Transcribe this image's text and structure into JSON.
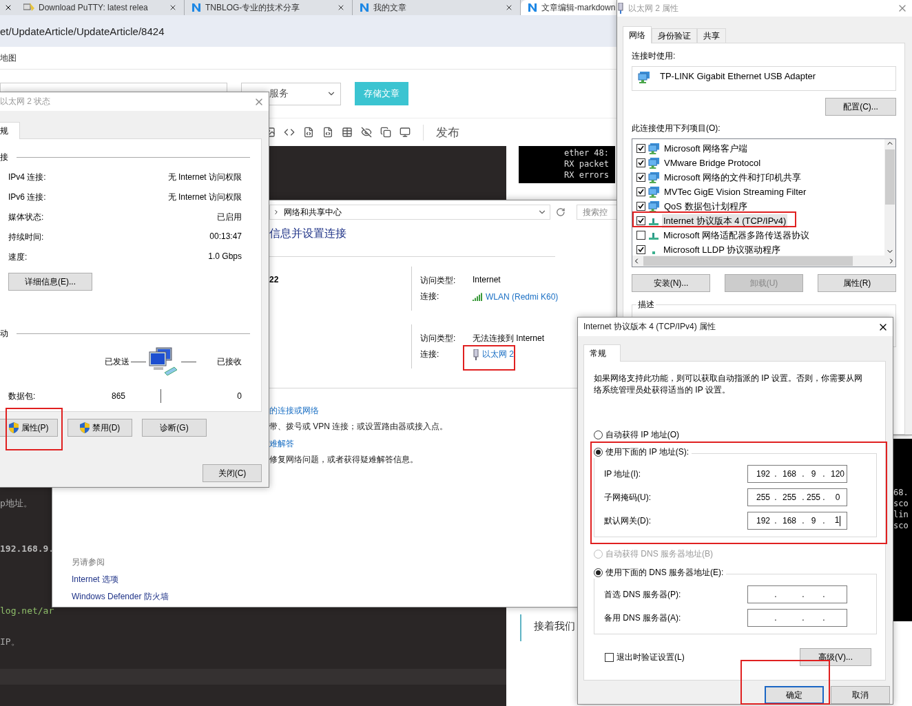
{
  "browser": {
    "tabs": [
      {
        "label": "Download PuTTY: latest relea",
        "kind": "putty",
        "selected": false
      },
      {
        "label": "TNBLOG-专业的技术分享",
        "kind": "blog",
        "selected": false
      },
      {
        "label": "我的文章",
        "kind": "blog",
        "selected": false
      },
      {
        "label": "文章编辑-markdown",
        "kind": "blog",
        "selected": true
      }
    ],
    "address": "et/UpdateArticle/UpdateArticle/8424",
    "nav": [
      "地图"
    ],
    "category_select": "服务",
    "save_button": "存储文章",
    "publish": "发布",
    "editor_lines": [
      {
        "text": "p地址。",
        "kind": "plain"
      },
      {
        "text": "192.168.9.",
        "kind": "number"
      },
      {
        "text": "log.net/ar",
        "kind": "link"
      },
      {
        "text": "IP。",
        "kind": "plain"
      }
    ],
    "terminal_lines": [
      "ether 48:",
      "RX packet",
      "RX errors"
    ],
    "terminal_lines_2": [
      "68.",
      "sco",
      "lin",
      "sco"
    ],
    "preview_quote": "接着我们"
  },
  "network_center": {
    "breadcrumb": "网络和共享中心",
    "search": {
      "placeholder": "搜索控"
    },
    "heading": "信息并设置连接",
    "network_name": "22",
    "connections": [
      {
        "access_label": "访问类型:",
        "access": "Internet",
        "conn_label": "连接:",
        "conn": "WLAN (Redmi K60)",
        "kind": "wifi"
      },
      {
        "access_label": "访问类型:",
        "access": "无法连接到 Internet",
        "conn_label": "连接:",
        "conn": "以太网 2",
        "kind": "ethernet"
      }
    ],
    "tasks": [
      {
        "link": "的连接或网络",
        "desc": "带、拨号或 VPN 连接；或设置路由器或接入点。"
      },
      {
        "link": "难解答",
        "desc": "修复网络问题，或者获得疑难解答信息。"
      }
    ],
    "see_also": {
      "title": "另请参阅",
      "links": [
        "Internet 选项",
        "Windows Defender 防火墙"
      ]
    }
  },
  "status_dialog": {
    "title": "以太网 2 状态",
    "tabs": [
      {
        "label": "规",
        "selected": true
      }
    ],
    "section_connection": "接",
    "rows": [
      {
        "label": "IPv4 连接:",
        "value": "无 Internet 访问权限"
      },
      {
        "label": "IPv6 连接:",
        "value": "无 Internet 访问权限"
      },
      {
        "label": "媒体状态:",
        "value": "已启用"
      },
      {
        "label": "持续时间:",
        "value": "00:13:47"
      },
      {
        "label": "速度:",
        "value": "1.0 Gbps"
      }
    ],
    "details_button": "详细信息(E)...",
    "section_activity": "动",
    "sent_label": "已发送",
    "received_label": "已接收",
    "packets_label": "数据包:",
    "packets_sent": "865",
    "packets_received": "0",
    "buttons": [
      {
        "label": "属性(P)",
        "shield": true
      },
      {
        "label": "禁用(D)",
        "shield": true
      },
      {
        "label": "诊断(G)",
        "shield": false
      }
    ],
    "close_button": "关闭(C)"
  },
  "properties_dialog": {
    "title": "以太网 2 属性",
    "tabs": [
      {
        "label": "网络",
        "selected": true
      },
      {
        "label": "身份验证",
        "selected": false
      },
      {
        "label": "共享",
        "selected": false
      }
    ],
    "connect_using_label": "连接时使用:",
    "adapter": "TP-LINK Gigabit Ethernet USB Adapter",
    "configure_button": "配置(C)...",
    "items_label": "此连接使用下列项目(O):",
    "items": [
      {
        "label": "Microsoft 网络客户端",
        "checked": true,
        "selected": false,
        "kind": "client"
      },
      {
        "label": "VMware Bridge Protocol",
        "checked": true,
        "selected": false,
        "kind": "service"
      },
      {
        "label": "Microsoft 网络的文件和打印机共享",
        "checked": true,
        "selected": false,
        "kind": "service"
      },
      {
        "label": "MVTec GigE Vision Streaming Filter",
        "checked": true,
        "selected": false,
        "kind": "service"
      },
      {
        "label": "QoS 数据包计划程序",
        "checked": true,
        "selected": false,
        "kind": "service"
      },
      {
        "label": "Internet 协议版本 4 (TCP/IPv4)",
        "checked": true,
        "selected": true,
        "kind": "protocol"
      },
      {
        "label": "Microsoft 网络适配器多路传送器协议",
        "checked": false,
        "selected": false,
        "kind": "protocol"
      },
      {
        "label": "Microsoft LLDP 协议驱动程序",
        "checked": true,
        "selected": false,
        "kind": "driver"
      }
    ],
    "buttons": [
      {
        "label": "安装(N)...",
        "disabled": false
      },
      {
        "label": "卸载(U)",
        "disabled": true
      },
      {
        "label": "属性(R)",
        "disabled": false
      }
    ],
    "description_label": "描述"
  },
  "tcpip_dialog": {
    "title": "Internet 协议版本 4 (TCP/IPv4) 属性",
    "tabs": [
      {
        "label": "常规",
        "selected": true
      }
    ],
    "intro": "如果网络支持此功能，则可以获取自动指派的 IP 设置。否则，你需要从网络系统管理员处获得适当的 IP 设置。",
    "ip_auto": {
      "label": "自动获得 IP 地址(O)",
      "selected": false,
      "disabled": false
    },
    "ip_manual": {
      "label": "使用下面的 IP 地址(S):",
      "selected": true
    },
    "ip_fields": [
      {
        "label": "IP 地址(I):",
        "octets": [
          "192",
          "168",
          "9",
          "120"
        ],
        "separator": "."
      },
      {
        "label": "子网掩码(U):",
        "octets": [
          "255",
          "255",
          "255",
          "0"
        ],
        "separator": "."
      },
      {
        "label": "默认网关(D):",
        "octets": [
          "192",
          "168",
          "9",
          "1"
        ],
        "separator": ".",
        "focused": true
      }
    ],
    "dns_auto": {
      "label": "自动获得 DNS 服务器地址(B)",
      "selected": false,
      "disabled": true
    },
    "dns_manual": {
      "label": "使用下面的 DNS 服务器地址(E):",
      "selected": true
    },
    "dns_fields": [
      {
        "label": "首选 DNS 服务器(P):",
        "separator": "."
      },
      {
        "label": "备用 DNS 服务器(A):",
        "separator": "."
      }
    ],
    "validate": {
      "label": "退出时验证设置(L)",
      "checked": false
    },
    "advanced_button": "高级(V)...",
    "ok_button": "确定",
    "cancel_button": "取消"
  }
}
